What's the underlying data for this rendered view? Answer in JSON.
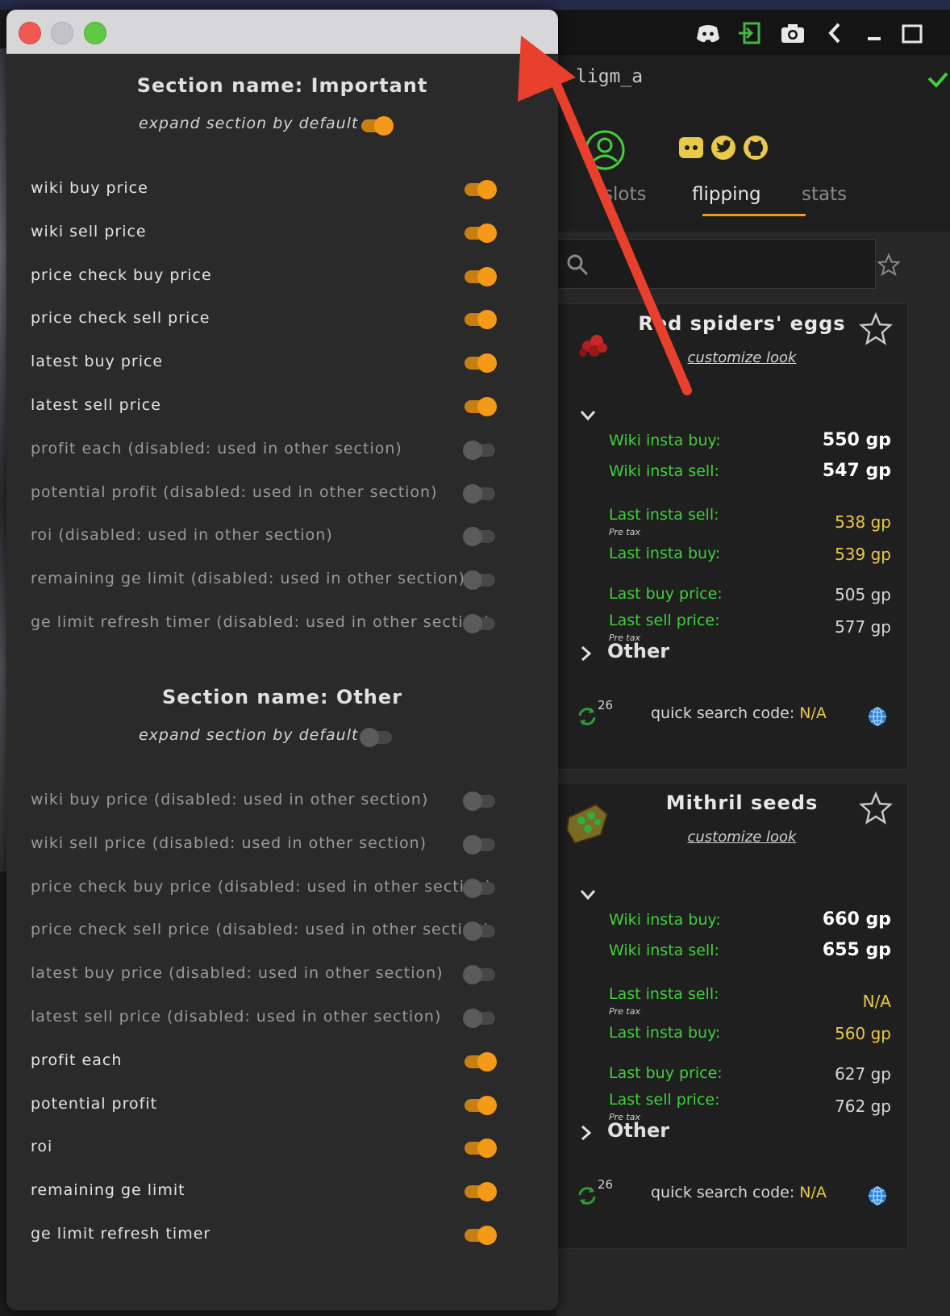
{
  "plugin": {
    "account_name": "ligm_a",
    "tabs": [
      "slots",
      "flipping",
      "stats"
    ],
    "active_tab": "flipping",
    "search": {
      "placeholder": ""
    },
    "items": [
      {
        "name": "Red spiders' eggs",
        "customize": "customize look",
        "rows": [
          {
            "label": "Wiki insta buy:",
            "value": "550 gp",
            "style": "big"
          },
          {
            "label": "Wiki insta sell:",
            "value": "547 gp",
            "style": "big"
          },
          {
            "label": "Last insta sell:",
            "value": "538 gp",
            "style": "yellow",
            "note": "Pre tax"
          },
          {
            "label": "Last insta buy:",
            "value": "539 gp",
            "style": "yellow"
          },
          {
            "label": "Last buy price:",
            "value": "505 gp",
            "style": "normal"
          },
          {
            "label": "Last sell price:",
            "value": "577 gp",
            "style": "normal",
            "note": "Pre tax"
          }
        ],
        "other_label": "Other",
        "refresh_count": "26",
        "quick_search_label": "quick search code:",
        "quick_search_value": "N/A"
      },
      {
        "name": "Mithril seeds",
        "customize": "customize look",
        "rows": [
          {
            "label": "Wiki insta buy:",
            "value": "660 gp",
            "style": "big"
          },
          {
            "label": "Wiki insta sell:",
            "value": "655 gp",
            "style": "big"
          },
          {
            "label": "Last insta sell:",
            "value": "N/A",
            "style": "yellow",
            "note": "Pre tax"
          },
          {
            "label": "Last insta buy:",
            "value": "560 gp",
            "style": "yellow"
          },
          {
            "label": "Last buy price:",
            "value": "627 gp",
            "style": "normal"
          },
          {
            "label": "Last sell price:",
            "value": "762 gp",
            "style": "normal",
            "note": "Pre tax"
          }
        ],
        "other_label": "Other",
        "refresh_count": "26",
        "quick_search_label": "quick search code:",
        "quick_search_value": "N/A"
      }
    ],
    "colors": {
      "accent": "#f09a20",
      "label_green": "#3fd03a",
      "value_yellow": "#e9c94a"
    }
  },
  "settings": {
    "sections": [
      {
        "title": "Section name: Important",
        "expand_label": "expand section by default",
        "expand_on": true,
        "rows": [
          {
            "label": "wiki buy price",
            "on": true,
            "disabled": false
          },
          {
            "label": "wiki sell price",
            "on": true,
            "disabled": false
          },
          {
            "label": "price check buy price",
            "on": true,
            "disabled": false
          },
          {
            "label": "price check sell price",
            "on": true,
            "disabled": false
          },
          {
            "label": "latest buy price",
            "on": true,
            "disabled": false
          },
          {
            "label": "latest sell price",
            "on": true,
            "disabled": false
          },
          {
            "label": "profit each (disabled: used in other section)",
            "on": false,
            "disabled": true
          },
          {
            "label": "potential profit (disabled: used in other section)",
            "on": false,
            "disabled": true
          },
          {
            "label": "roi (disabled: used in other section)",
            "on": false,
            "disabled": true
          },
          {
            "label": "remaining ge limit (disabled: used in other section)",
            "on": false,
            "disabled": true
          },
          {
            "label": "ge limit refresh timer (disabled: used in other section)",
            "on": false,
            "disabled": true
          }
        ]
      },
      {
        "title": "Section name: Other",
        "expand_label": "expand section by default",
        "expand_on": false,
        "rows": [
          {
            "label": "wiki buy price (disabled: used in other section)",
            "on": false,
            "disabled": true
          },
          {
            "label": "wiki sell price (disabled: used in other section)",
            "on": false,
            "disabled": true
          },
          {
            "label": "price check buy price (disabled: used in other section)",
            "on": false,
            "disabled": true
          },
          {
            "label": "price check sell price (disabled: used in other section)",
            "on": false,
            "disabled": true
          },
          {
            "label": "latest buy price (disabled: used in other section)",
            "on": false,
            "disabled": true
          },
          {
            "label": "latest sell price (disabled: used in other section)",
            "on": false,
            "disabled": true
          },
          {
            "label": "profit each",
            "on": true,
            "disabled": false
          },
          {
            "label": "potential profit",
            "on": true,
            "disabled": false
          },
          {
            "label": "roi",
            "on": true,
            "disabled": false
          },
          {
            "label": "remaining ge limit",
            "on": true,
            "disabled": false
          },
          {
            "label": "ge limit refresh timer",
            "on": true,
            "disabled": false
          }
        ]
      }
    ],
    "colors": {
      "toggle_on": "#f59a18",
      "toggle_off": "#474747"
    }
  },
  "annotation": {
    "color": "#e8402c"
  }
}
